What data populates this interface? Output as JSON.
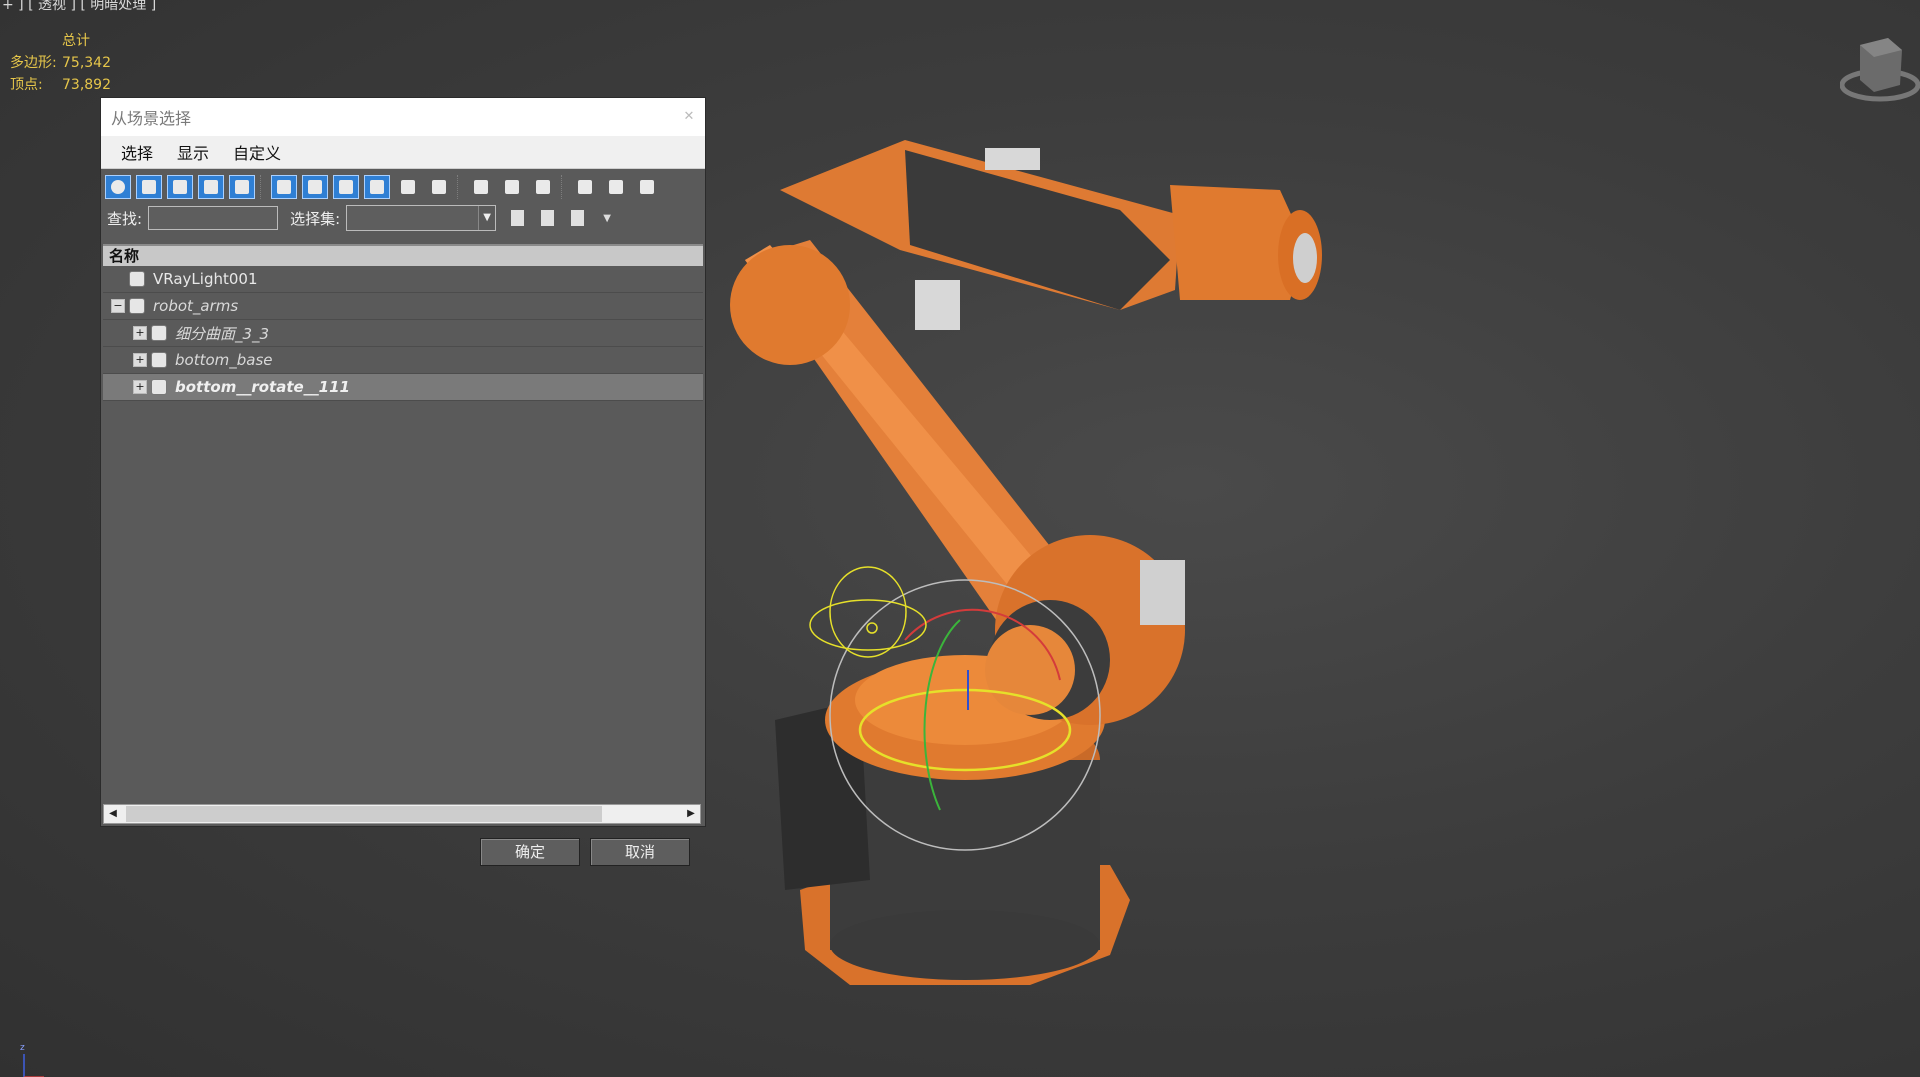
{
  "viewport": {
    "label": "+ ] [ 透视 ] [ 明暗处理 ]",
    "stats": {
      "header": "总计",
      "poly_label": "多边形:",
      "poly_value": "75,342",
      "vert_label": "顶点:",
      "vert_value": "73,892"
    },
    "axis_label": "z"
  },
  "dialog": {
    "title": "从场景选择",
    "close_glyph": "✕",
    "menu": [
      "选择",
      "显示",
      "自定义"
    ],
    "find_label": "查找:",
    "find_value": "",
    "selset_label": "选择集:",
    "selset_value": "",
    "column_header": "名称",
    "rows": [
      {
        "name": "VRayLight001",
        "style": "normal",
        "level": 0,
        "expand": ""
      },
      {
        "name": "robot_arms",
        "style": "italic",
        "level": 0,
        "expand": "−"
      },
      {
        "name": "细分曲面_3_3",
        "style": "italic",
        "level": 1,
        "expand": "+"
      },
      {
        "name": "bottom_base",
        "style": "italic",
        "level": 1,
        "expand": "+"
      },
      {
        "name": "bottom__rotate__111",
        "style": "bold",
        "level": 1,
        "expand": "+"
      }
    ],
    "ok_label": "确定",
    "cancel_label": "取消"
  },
  "colors": {
    "accent": "#2f7fd4",
    "robot_orange": "#e07a2f",
    "gizmo_yellow": "#e6e02a",
    "stats_yellow": "#e6c64a"
  }
}
